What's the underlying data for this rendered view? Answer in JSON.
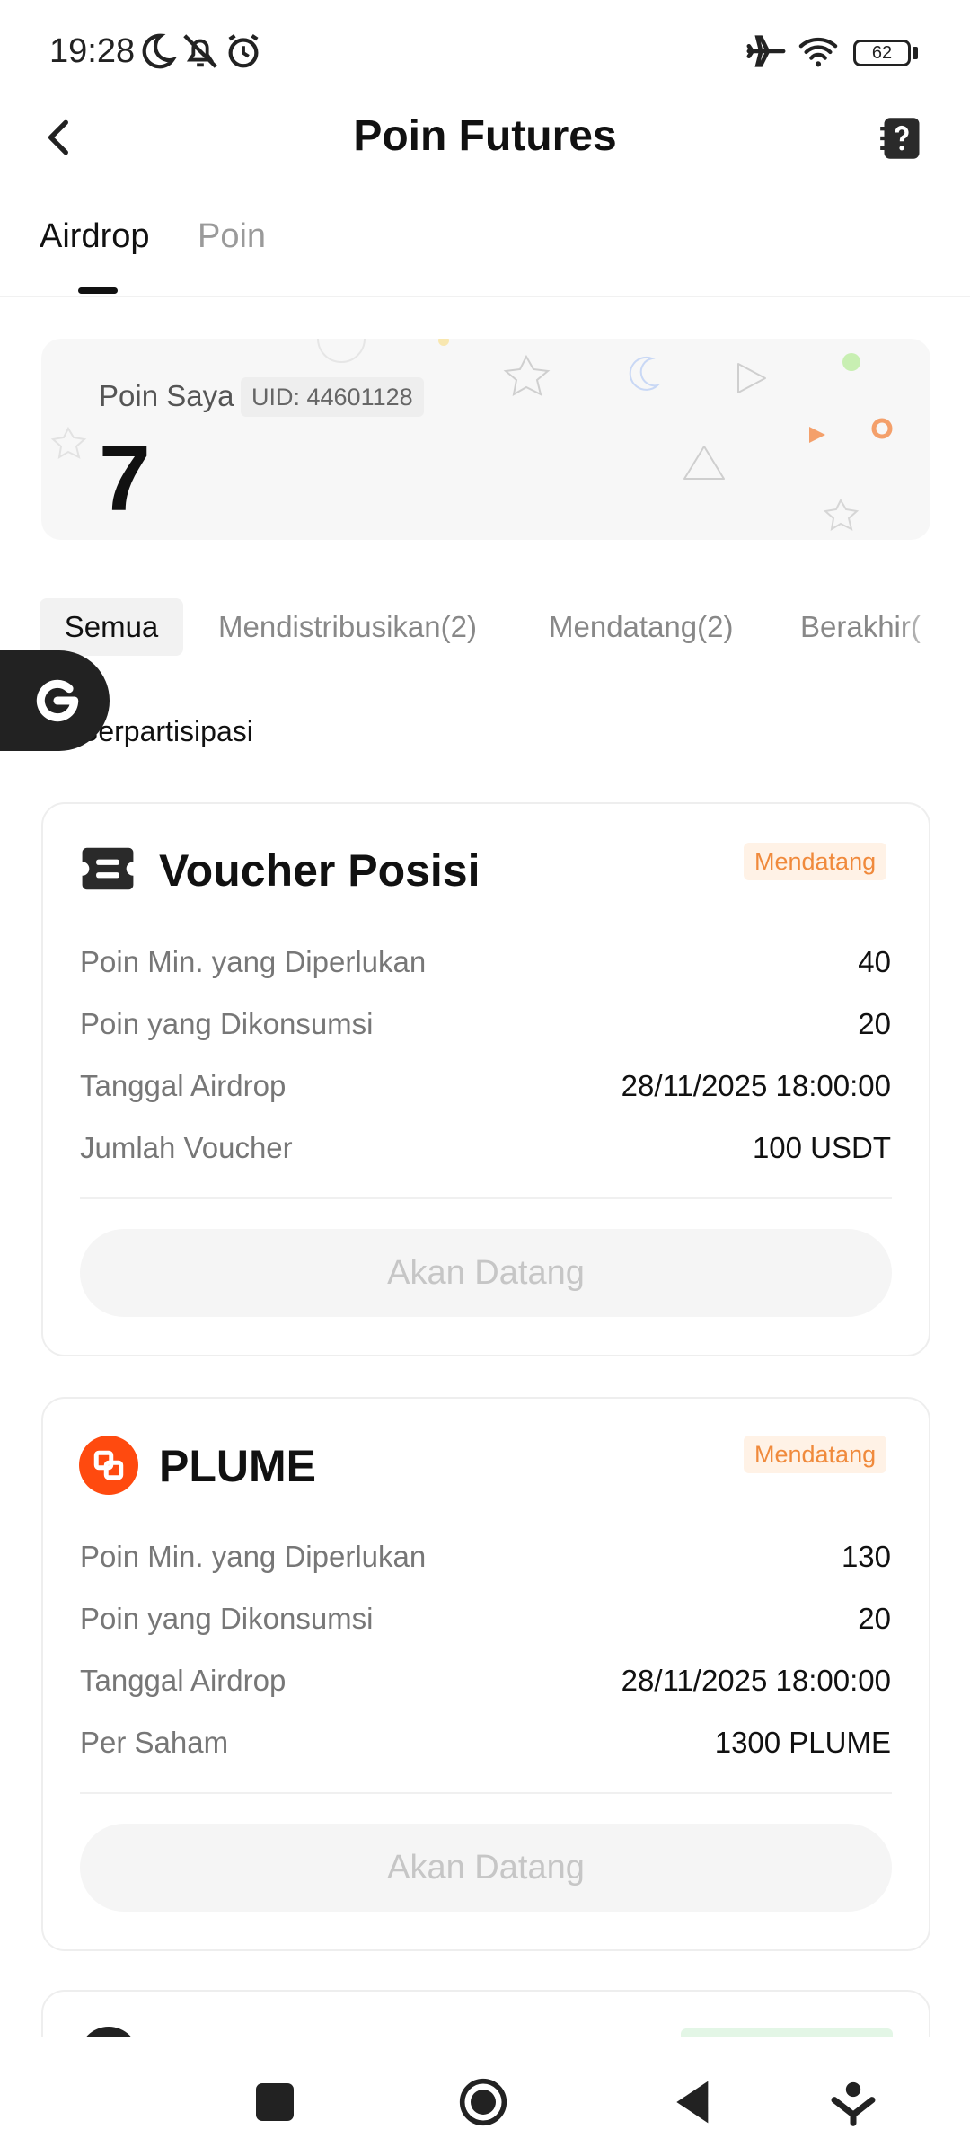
{
  "status_bar": {
    "time": "19:28",
    "battery": "62",
    "icons": [
      "moon-icon",
      "bell-off-icon",
      "alarm-icon",
      "airplane-icon",
      "wifi-icon",
      "battery-icon"
    ]
  },
  "header": {
    "title": "Poin Futures",
    "icons": [
      "back-arrow-icon",
      "help-book-icon"
    ]
  },
  "tabs": [
    {
      "label": "Airdrop",
      "active": true
    },
    {
      "label": "Poin",
      "active": false
    }
  ],
  "points": {
    "label": "Poin Saya",
    "uid": "UID: 44601128",
    "value": "7"
  },
  "filters": [
    {
      "label": "Semua",
      "active": true
    },
    {
      "label": "Mendistribusikan(2)",
      "active": false
    },
    {
      "label": "Mendatang(2)",
      "active": false
    },
    {
      "label": "Berakhir(",
      "active": false
    }
  ],
  "participated_label": "Berpartisipasi",
  "cards": [
    {
      "title": "Voucher Posisi",
      "icon": "ticket-icon",
      "status": "Mendatang",
      "rows": [
        {
          "label": "Poin Min. yang Diperlukan",
          "value": "40"
        },
        {
          "label": "Poin yang Dikonsumsi",
          "value": "20"
        },
        {
          "label": "Tanggal Airdrop",
          "value": "28/11/2025 18:00:00"
        },
        {
          "label": "Jumlah Voucher",
          "value": "100 USDT"
        }
      ],
      "button": "Akan Datang"
    },
    {
      "title": "PLUME",
      "icon": "plume-logo-icon",
      "status": "Mendatang",
      "rows": [
        {
          "label": "Poin Min. yang Diperlukan",
          "value": "130"
        },
        {
          "label": "Poin yang Dikonsumsi",
          "value": "20"
        },
        {
          "label": "Tanggal Airdrop",
          "value": "28/11/2025 18:00:00"
        },
        {
          "label": "Per Saham",
          "value": "1300 PLUME"
        }
      ],
      "button": "Akan Datang"
    }
  ],
  "nav_icons": [
    "recents-square-icon",
    "home-circle-icon",
    "back-triangle-icon",
    "download-icon"
  ],
  "colors": {
    "status_badge_bg": "#fff2e6",
    "status_badge_text": "#f08a3c",
    "plume_brand": "#ff4a0f"
  }
}
